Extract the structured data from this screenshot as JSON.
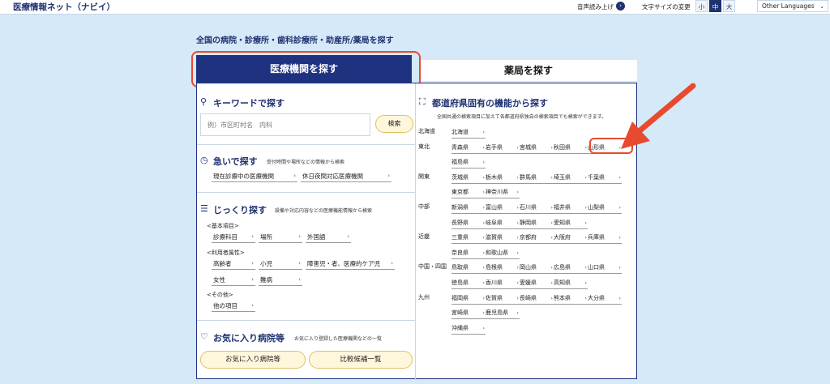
{
  "header": {
    "site_title": "医療情報ネット（ナビイ）",
    "voice_label": "音声読み上げ",
    "font_size_label": "文字サイズの変更",
    "font_sizes": [
      "小",
      "中",
      "大"
    ],
    "active_font_size": "中",
    "language_label": "Other Languages"
  },
  "main": {
    "heading": "全国の病院・診療所・歯科診療所・助産所/薬局を探す",
    "tabs": [
      {
        "label": "医療機関を探す",
        "active": true
      },
      {
        "label": "薬局を探す",
        "active": false
      }
    ]
  },
  "keyword": {
    "title": "キーワードで探す",
    "placeholder": "例）市区町村名　内科",
    "button": "検索"
  },
  "urgent": {
    "title": "急いで探す",
    "desc": "受付時間や場所などの情報から検索",
    "links": [
      "現在診療中の医療機関",
      "休日夜間対応医療機関"
    ]
  },
  "detail": {
    "title": "じっくり探す",
    "desc": "設備や対応内容などの医療機能情報から検索",
    "basic_label": "<基本項目>",
    "basic_links": [
      "診療科目",
      "場所",
      "外国語"
    ],
    "user_label": "<利用者属性>",
    "user_links": [
      "高齢者",
      "小児",
      "障害児・者、医療的ケア児",
      "女性",
      "難病"
    ],
    "other_label": "<その他>",
    "other_links": [
      "他の項目"
    ]
  },
  "favorites": {
    "title": "お気に入り病院等",
    "desc": "お気に入り登録した医療機関などの一覧",
    "buttons": [
      "お気に入り病院等",
      "比較候補一覧"
    ]
  },
  "prefecture": {
    "title": "都道府県固有の機能から探す",
    "desc": "全国共通の検索項目に加えて各都道府県独自の検索項目でも検索ができます。",
    "highlighted": "山形県",
    "regions": [
      {
        "name": "北海道",
        "rows": [
          [
            "北海道"
          ]
        ]
      },
      {
        "name": "東北",
        "rows": [
          [
            "青森県",
            "岩手県",
            "宮城県",
            "秋田県",
            "山形県"
          ],
          [
            "福島県"
          ]
        ]
      },
      {
        "name": "関東",
        "rows": [
          [
            "茨城県",
            "栃木県",
            "群馬県",
            "埼玉県",
            "千葉県"
          ],
          [
            "東京都",
            "神奈川県"
          ]
        ]
      },
      {
        "name": "中部",
        "rows": [
          [
            "新潟県",
            "富山県",
            "石川県",
            "福井県",
            "山梨県"
          ],
          [
            "長野県",
            "岐阜県",
            "静岡県",
            "愛知県"
          ]
        ]
      },
      {
        "name": "近畿",
        "rows": [
          [
            "三重県",
            "滋賀県",
            "京都府",
            "大阪府",
            "兵庫県"
          ],
          [
            "奈良県",
            "和歌山県"
          ]
        ]
      },
      {
        "name": "中国・四国",
        "rows": [
          [
            "鳥取県",
            "島根県",
            "岡山県",
            "広島県",
            "山口県"
          ],
          [
            "徳島県",
            "香川県",
            "愛媛県",
            "高知県"
          ]
        ]
      },
      {
        "name": "九州",
        "rows": [
          [
            "福岡県",
            "佐賀県",
            "長崎県",
            "熊本県",
            "大分県"
          ],
          [
            "宮崎県",
            "鹿児島県"
          ],
          [
            "沖縄県"
          ]
        ]
      }
    ]
  },
  "colors": {
    "accent": "#1f3280",
    "annotation": "#e84a2f",
    "button_bg": "#fff7dc"
  }
}
